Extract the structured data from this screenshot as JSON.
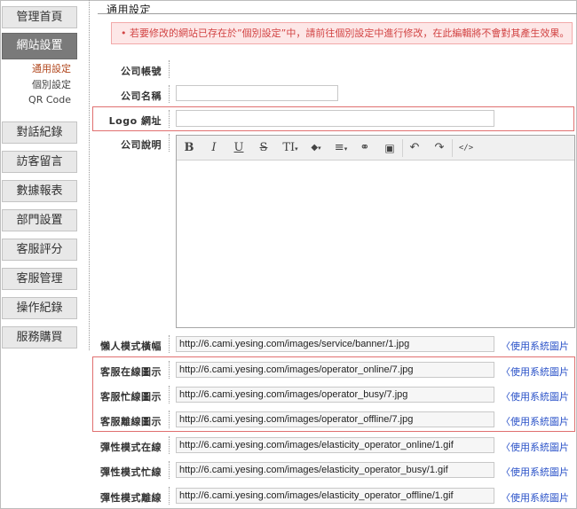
{
  "sidebar": {
    "items": [
      {
        "label": "管理首頁"
      },
      {
        "label": "網站設置"
      },
      {
        "label": "對話紀錄"
      },
      {
        "label": "訪客留言"
      },
      {
        "label": "數據報表"
      },
      {
        "label": "部門設置"
      },
      {
        "label": "客服評分"
      },
      {
        "label": "客服管理"
      },
      {
        "label": "操作紀錄"
      },
      {
        "label": "服務購買"
      }
    ],
    "subitems": [
      {
        "label": "通用設定"
      },
      {
        "label": "個別設定"
      },
      {
        "label": "QR Code"
      }
    ]
  },
  "header": {
    "title": "通用設定"
  },
  "notice": {
    "text": "•  若要修改的網站已存在於”個別設定”中，請前往個別設定中進行修改，在此編輯將不會對其產生效果。"
  },
  "form": {
    "account_label": "公司帳號",
    "name_label": "公司名稱",
    "name_value": "",
    "logo_label": "Logo 網址",
    "logo_value": "",
    "desc_label": "公司說明"
  },
  "editor": {
    "tools": {
      "bold": "B",
      "italic": "I",
      "underline": "U",
      "strike": "S",
      "text_size": "TI",
      "color": "◆",
      "align": "≡",
      "link": "⚭",
      "image": "▣",
      "undo": "↶",
      "redo": "↷",
      "code": "</>"
    }
  },
  "image_rows": [
    {
      "label": "懶人模式橫幅",
      "value": "http://6.cami.yesing.com/images/service/banner/1.jpg",
      "link": "〈使用系統圖片"
    },
    {
      "label": "客服在線圖示",
      "value": "http://6.cami.yesing.com/images/operator_online/7.jpg",
      "link": "〈使用系統圖片"
    },
    {
      "label": "客服忙線圖示",
      "value": "http://6.cami.yesing.com/images/operator_busy/7.jpg",
      "link": "〈使用系統圖片"
    },
    {
      "label": "客服離線圖示",
      "value": "http://6.cami.yesing.com/images/operator_offline/7.jpg",
      "link": "〈使用系統圖片"
    },
    {
      "label": "彈性模式在線",
      "value": "http://6.cami.yesing.com/images/elasticity_operator_online/1.gif",
      "link": "〈使用系統圖片"
    },
    {
      "label": "彈性模式忙線",
      "value": "http://6.cami.yesing.com/images/elasticity_operator_busy/1.gif",
      "link": "〈使用系統圖片"
    },
    {
      "label": "彈性模式離線",
      "value": "http://6.cami.yesing.com/images/elasticity_operator_offline/1.gif",
      "link": "〈使用系統圖片"
    }
  ],
  "colors": {
    "highlight": "#e07070",
    "notice_bg": "#fde7e7",
    "notice_text": "#d24444",
    "link": "#2a52c8",
    "active_nav": "#7a7a7a"
  }
}
